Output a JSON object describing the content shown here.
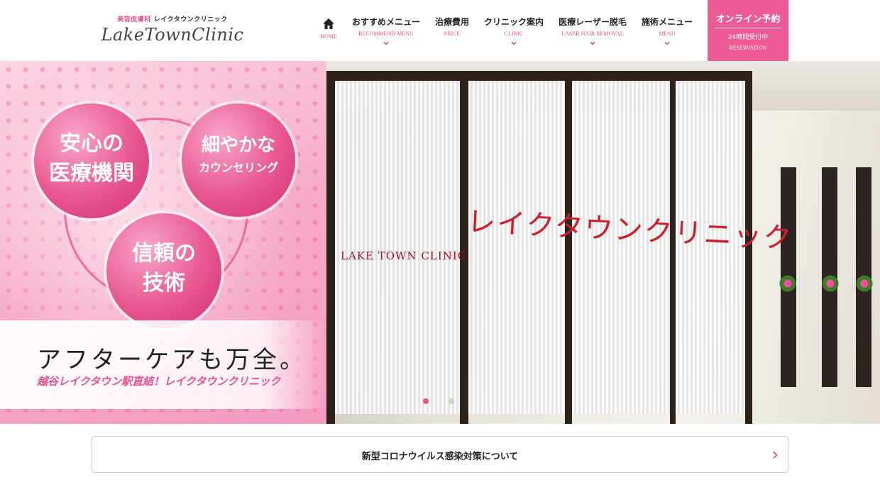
{
  "header": {
    "logo": {
      "sub_pink": "美容皮膚科",
      "sub_dark": "レイクタウンクリニック",
      "main": "LakeTownClinic"
    },
    "nav": [
      {
        "label": "",
        "en": "HOME",
        "icon": "home-icon"
      },
      {
        "label": "おすすめメニュー",
        "en": "RECOMMEND MENU",
        "icon": "chevron-down-icon"
      },
      {
        "label": "治療費用",
        "en": "PRICE",
        "icon": ""
      },
      {
        "label": "クリニック案内",
        "en": "CLINIC",
        "icon": "chevron-down-icon"
      },
      {
        "label": "医療レーザー脱毛",
        "en": "LASER HAIR REMOVAL",
        "icon": "chevron-down-icon"
      },
      {
        "label": "施術メニュー",
        "en": "MENU",
        "icon": "chevron-down-icon"
      }
    ],
    "reserve": {
      "main": "オンライン予約",
      "sub": "24時間受付中",
      "en": "RESERVATION",
      "color": "#ec5b94"
    }
  },
  "hero": {
    "circles": {
      "c1_line1": "安心の",
      "c1_line2": "医療機関",
      "c2_line1": "細やかな",
      "c2_line2": "カウンセリング",
      "c3_line1": "信頼の",
      "c3_line2": "技術"
    },
    "tagline": "アフターケアも万全。",
    "subtagline": "越谷レイクタウン駅直結！レイクタウンクリニック",
    "door_logo": "LAKE TOWN CLINIC",
    "door_sign": "レイクタウンクリニック",
    "slides": 2,
    "active_slide": 1
  },
  "notice": {
    "text": "新型コロナウイルス感染対策について",
    "icon": "chevron-right-icon"
  },
  "colors": {
    "accent": "#e8528c",
    "door_sign": "#cc1f2b"
  }
}
